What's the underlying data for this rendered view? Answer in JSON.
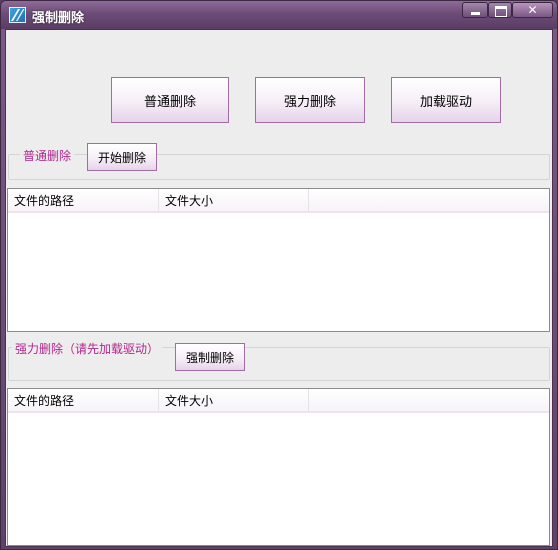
{
  "window": {
    "title": "强制删除",
    "close_glyph": "✕"
  },
  "toolbar": {
    "normal_delete": "普通删除",
    "force_delete": "强力删除",
    "load_driver": "加载驱动"
  },
  "normal_group": {
    "label": "普通删除",
    "start_button": "开始删除",
    "columns": [
      "文件的路径",
      "文件大小",
      ""
    ]
  },
  "force_group": {
    "label": "强力删除（请先加载驱动）",
    "force_button": "强制删除",
    "columns": [
      "文件的路径",
      "文件大小",
      ""
    ]
  }
}
